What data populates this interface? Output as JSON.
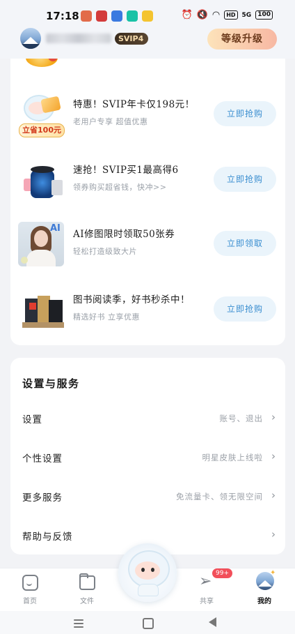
{
  "status_bar": {
    "time": "17:18",
    "hd_label": "HD",
    "network_label": "5G",
    "battery": "100"
  },
  "header": {
    "svip_badge": "SVIP4",
    "upgrade_button": "等级升级"
  },
  "promos": [
    {
      "title": "特惠！SVIP年卡仅198元！",
      "subtitle": "老用户专享 超值优惠",
      "button": "立即抢购",
      "tag": "立省100元",
      "icon": "svip-mascot-ticket-image"
    },
    {
      "title": "速抢！SVIP买1最高得6",
      "subtitle": "领券购买超省钱，快冲>>",
      "button": "立即抢购",
      "icon": "speaker-bundle-image"
    },
    {
      "title": "AI修图限时领取50张券",
      "subtitle": "轻松打造级致大片",
      "button": "立即领取",
      "icon": "ai-portrait-image",
      "image_text": "AI"
    },
    {
      "title": "图书阅读季，好书秒杀中！",
      "subtitle": "精选好书 立享优惠",
      "button": "立即抢购",
      "icon": "books-image"
    }
  ],
  "settings": {
    "title": "设置与服务",
    "rows": [
      {
        "label": "设置",
        "value": "账号、退出"
      },
      {
        "label": "个性设置",
        "value": "明星皮肤上线啦"
      },
      {
        "label": "更多服务",
        "value": "免流量卡、领无限空间"
      },
      {
        "label": "帮助与反馈",
        "value": ""
      }
    ]
  },
  "bottom_nav": {
    "items": [
      {
        "label": "首页",
        "icon": "home-icon"
      },
      {
        "label": "文件",
        "icon": "file-icon"
      },
      {
        "label": "共享",
        "icon": "share-send-icon",
        "badge": "99+"
      },
      {
        "label": "我的",
        "icon": "profile-avatar-icon",
        "active": true
      }
    ]
  },
  "colors": {
    "accent_blue": "#3a8ed0",
    "button_bg": "#eaf4fb",
    "upgrade_gradient_start": "#fde3ba",
    "upgrade_gradient_end": "#f7b8a3",
    "badge_red": "#f24f5a",
    "page_bg": "#f2f3f6"
  }
}
